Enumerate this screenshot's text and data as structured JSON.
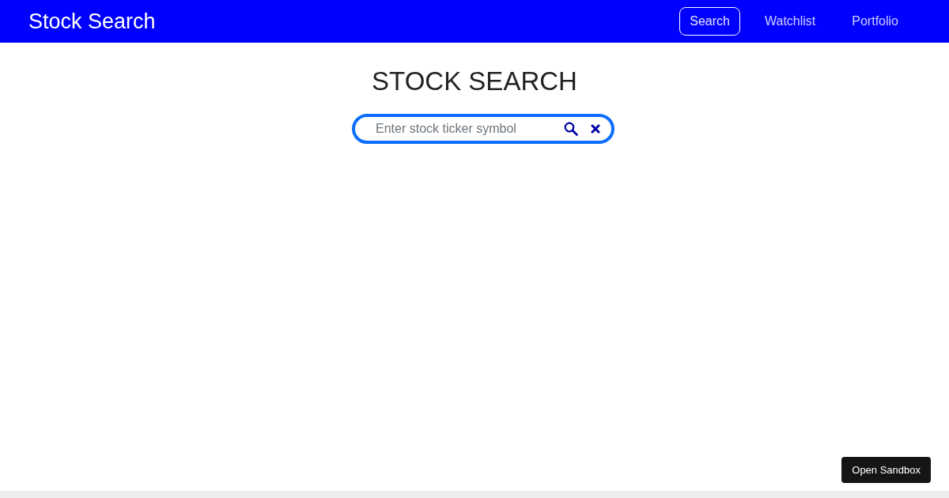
{
  "navbar": {
    "brand": "Stock Search",
    "links": [
      {
        "label": "Search",
        "selected": true
      },
      {
        "label": "Watchlist",
        "selected": false
      },
      {
        "label": "Portfolio",
        "selected": false
      }
    ]
  },
  "heading": "STOCK SEARCH",
  "search": {
    "placeholder": "Enter stock ticker symbol"
  },
  "sandbox_button": "Open Sandbox"
}
